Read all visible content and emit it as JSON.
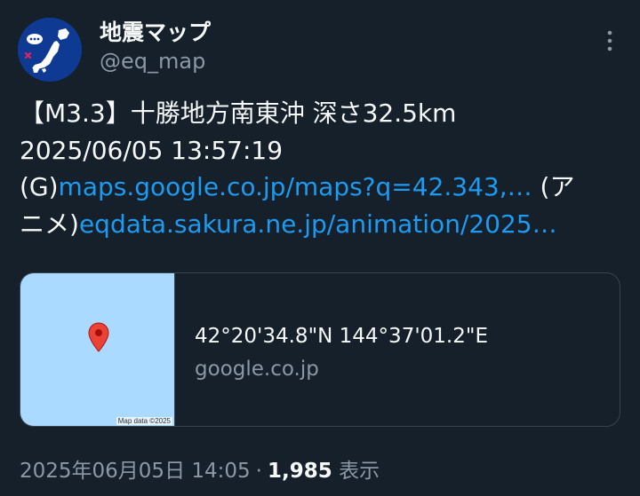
{
  "user": {
    "display_name": "地震マップ",
    "handle": "@eq_map",
    "avatar_icon": "japan-map-avatar-icon"
  },
  "menu": {
    "more_icon": "more-vertical-icon"
  },
  "tweet": {
    "line1": "【M3.3】十勝地方南東沖 深さ32.5km",
    "line2": "2025/06/05 13:57:19",
    "g_prefix": "(G)",
    "g_link": "maps.google.co.jp/maps?q=42.343,…",
    "anime_open": " (ア",
    "anime_close": "ニメ)",
    "anime_link": "eqdata.sakura.ne.jp/animation/2025…"
  },
  "card": {
    "title": "42°20'34.8\"N 144°37'01.2\"E",
    "domain": "google.co.jp",
    "map_attribution": "Map data ©2025",
    "pin_icon": "map-pin-icon"
  },
  "meta": {
    "timestamp": "2025年06月05日 14:05",
    "separator": "·",
    "views_count": "1,985",
    "views_label": "表示"
  },
  "colors": {
    "background": "#15202b",
    "text": "#f7f9f9",
    "secondary": "#8b98a5",
    "link": "#1d9bf0",
    "border": "#38444d",
    "map_water": "#aadaff",
    "pin": "#ea4335"
  }
}
